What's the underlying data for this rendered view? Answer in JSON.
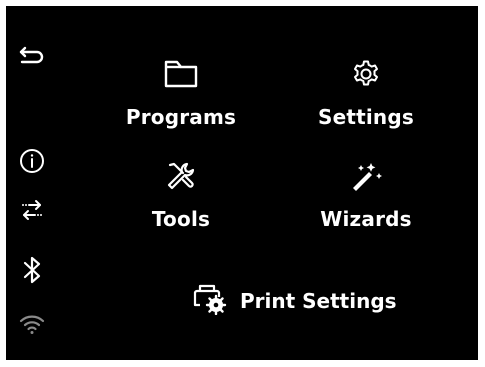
{
  "sidebar": {
    "back_icon": "back-arrow-icon",
    "info_icon": "info-icon",
    "transfer_icon": "transfer-arrows-icon",
    "bluetooth_icon": "bluetooth-icon",
    "wifi_icon": "wifi-icon"
  },
  "menu": {
    "items": [
      {
        "label": "Programs",
        "icon": "folder-icon"
      },
      {
        "label": "Settings",
        "icon": "gear-icon"
      },
      {
        "label": "Tools",
        "icon": "tools-icon"
      },
      {
        "label": "Wizards",
        "icon": "magic-wand-icon"
      }
    ],
    "print_settings": {
      "label": "Print Settings",
      "icon": "print-settings-icon"
    }
  },
  "colors": {
    "background": "#000000",
    "foreground": "#ffffff",
    "wifi_dim": "#8a8a8a"
  }
}
